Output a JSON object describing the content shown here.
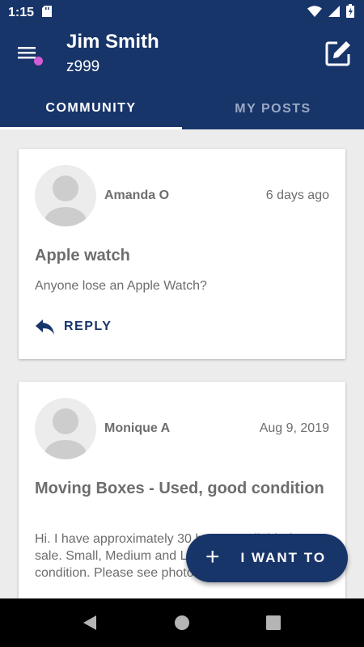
{
  "status_bar": {
    "time": "1:15"
  },
  "header": {
    "user_name": "Jim Smith",
    "user_id": "z999"
  },
  "tabs": [
    {
      "label": "COMMUNITY",
      "active": true
    },
    {
      "label": "MY POSTS",
      "active": false
    }
  ],
  "posts": [
    {
      "author": "Amanda O",
      "date": "6 days ago",
      "title": "Apple watch",
      "body": "Anyone lose an Apple Watch?",
      "reply_label": "REPLY"
    },
    {
      "author": "Monique A",
      "date": "Aug 9, 2019",
      "title": "Moving Boxes - Used, good condition",
      "body": "Hi. I have approximately 30 boxes available for sale. Small, Medium and Large. They are in good condition. Please see photos. If interested,"
    }
  ],
  "fab": {
    "label": "I WANT TO"
  },
  "colors": {
    "primary": "#18356a",
    "badge": "#d05cd6"
  }
}
